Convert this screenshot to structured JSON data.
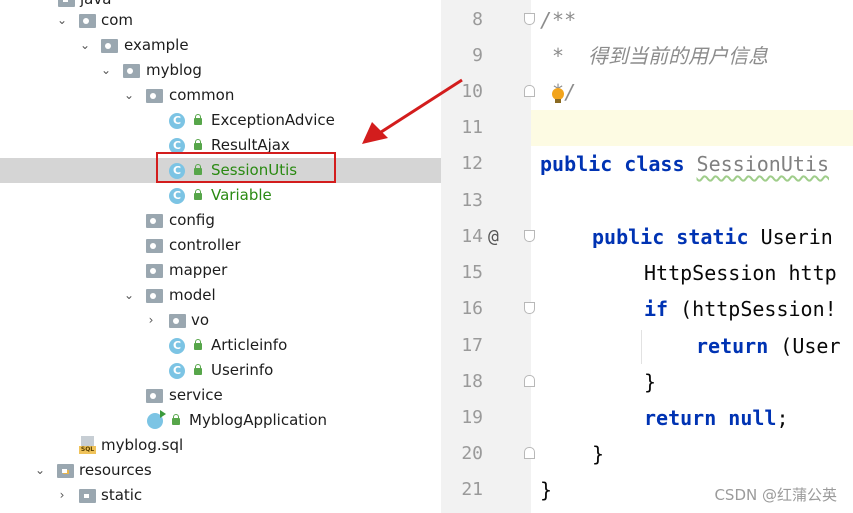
{
  "project_tree": {
    "partial_top_label": "java",
    "items": [
      {
        "label": "com"
      },
      {
        "label": "example"
      },
      {
        "label": "myblog"
      },
      {
        "label": "common"
      },
      {
        "label": "ExceptionAdvice"
      },
      {
        "label": "ResultAjax"
      },
      {
        "label": "SessionUtis"
      },
      {
        "label": "Variable"
      },
      {
        "label": "config"
      },
      {
        "label": "controller"
      },
      {
        "label": "mapper"
      },
      {
        "label": "model"
      },
      {
        "label": "vo"
      },
      {
        "label": "Articleinfo"
      },
      {
        "label": "Userinfo"
      },
      {
        "label": "service"
      },
      {
        "label": "MyblogApplication"
      },
      {
        "label": "myblog.sql"
      },
      {
        "label": "resources"
      },
      {
        "label": "static"
      }
    ],
    "class_icon_letter": "C",
    "sql_icon_text": "SQL",
    "highlight_color": "#d31d1d",
    "added_file_color": "#2a8a12"
  },
  "editor": {
    "line_numbers": [
      "8",
      "9",
      "10",
      "11",
      "12",
      "13",
      "14",
      "15",
      "16",
      "17",
      "18",
      "19",
      "20",
      "21"
    ],
    "gutter_marker": "@",
    "lines": {
      "l8": "/**",
      "l9": " *  得到当前的用户信息",
      "l10": " */",
      "l12_kw": "public class ",
      "l12_name": "SessionUtis",
      "l14_kw": "public static ",
      "l14_rest": "Userin",
      "l15": "HttpSession http",
      "l16_kw": "if ",
      "l16_rest": "(httpSession!",
      "l17_kw": "return ",
      "l17_rest": "(User",
      "l18": "}",
      "l19_kw": "return null",
      "l19_rest": ";",
      "l20": "}",
      "l21": "}"
    },
    "keyword_color": "#0033b3",
    "comment_color": "#8c8c8c"
  },
  "watermark": "CSDN @红蒲公英"
}
